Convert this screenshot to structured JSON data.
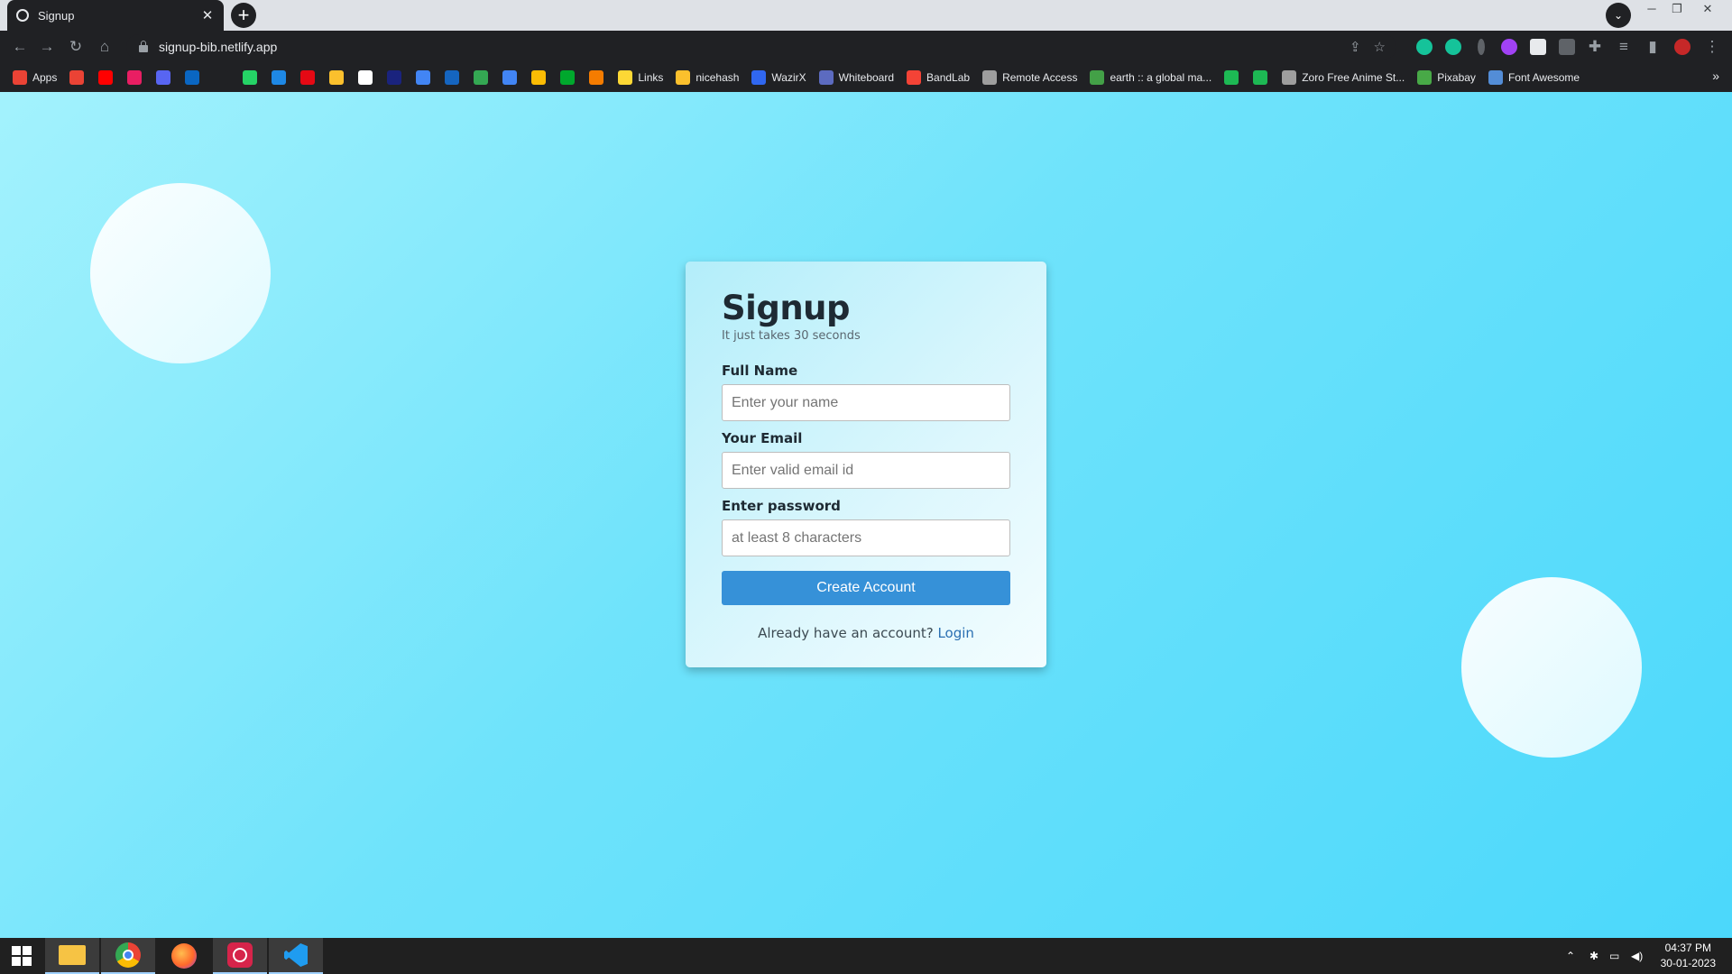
{
  "browser": {
    "tab_title": "Signup",
    "tab_close": "✕",
    "new_tab": "+",
    "tab_search": "⌄",
    "url": "signup-bib.netlify.app",
    "bookmarks": [
      {
        "label": "Apps",
        "color": "#ea4335",
        "icon": "apps-grid-icon"
      },
      {
        "label": "",
        "color": "#ea4335",
        "icon": "gmail-icon"
      },
      {
        "label": "",
        "color": "#ff0000",
        "icon": "youtube-icon"
      },
      {
        "label": "",
        "color": "#e91e63",
        "icon": "music-icon"
      },
      {
        "label": "",
        "color": "#5865f2",
        "icon": "discord-icon"
      },
      {
        "label": "",
        "color": "#0a66c2",
        "icon": "linkedin-icon"
      },
      {
        "label": "",
        "color": "#202124",
        "icon": "github-icon"
      },
      {
        "label": "",
        "color": "#25d366",
        "icon": "whatsapp-icon"
      },
      {
        "label": "",
        "color": "#1e88e5",
        "icon": "play-icon"
      },
      {
        "label": "",
        "color": "#e50914",
        "icon": "netflix-icon"
      },
      {
        "label": "",
        "color": "#fbc02d",
        "icon": "notes-icon"
      },
      {
        "label": "",
        "color": "#ffffff",
        "icon": "amazon-icon"
      },
      {
        "label": "",
        "color": "#1a237e",
        "icon": "translate-icon"
      },
      {
        "label": "",
        "color": "#4285f4",
        "icon": "docs-icon"
      },
      {
        "label": "",
        "color": "#1565c0",
        "icon": "dp-icon"
      },
      {
        "label": "",
        "color": "#34a853",
        "icon": "drive-icon"
      },
      {
        "label": "",
        "color": "#4285f4",
        "icon": "calendar-icon"
      },
      {
        "label": "",
        "color": "#fbbc04",
        "icon": "keep-icon"
      },
      {
        "label": "",
        "color": "#00a82d",
        "icon": "evernote-icon"
      },
      {
        "label": "",
        "color": "#f57c00",
        "icon": "puzzle-icon"
      },
      {
        "label": "Links",
        "color": "#fdd835",
        "icon": "folder-icon"
      },
      {
        "label": "nicehash",
        "color": "#fbc02d",
        "icon": "nicehash-icon"
      },
      {
        "label": "WazirX",
        "color": "#3067f0",
        "icon": "wazirx-icon"
      },
      {
        "label": "Whiteboard",
        "color": "#5c6bc0",
        "icon": "whiteboard-icon"
      },
      {
        "label": "BandLab",
        "color": "#f44336",
        "icon": "bandlab-icon"
      },
      {
        "label": "Remote Access",
        "color": "#9e9e9e",
        "icon": "remote-icon"
      },
      {
        "label": "earth :: a global ma...",
        "color": "#43a047",
        "icon": "earth-icon"
      },
      {
        "label": "",
        "color": "#1db954",
        "icon": "tv-icon"
      },
      {
        "label": "",
        "color": "#1db954",
        "icon": "tv-icon-2"
      },
      {
        "label": "Zoro Free Anime St...",
        "color": "#9e9e9e",
        "icon": "zoro-icon"
      },
      {
        "label": "Pixabay",
        "color": "#48a947",
        "icon": "pixabay-icon"
      },
      {
        "label": "Font Awesome",
        "color": "#538dd7",
        "icon": "flag-icon"
      }
    ],
    "bookmarks_more": "»"
  },
  "form": {
    "title": "Signup",
    "subtitle": "It just takes 30 seconds",
    "name_label": "Full Name",
    "name_placeholder": "Enter your name",
    "email_label": "Your Email",
    "email_placeholder": "Enter valid email id",
    "password_label": "Enter password",
    "password_placeholder": "at least 8 characters",
    "submit_label": "Create Account",
    "footer_text": "Already have an account? ",
    "login_link": "Login"
  },
  "taskbar": {
    "time": "04:37 PM",
    "date": "30-01-2023"
  }
}
